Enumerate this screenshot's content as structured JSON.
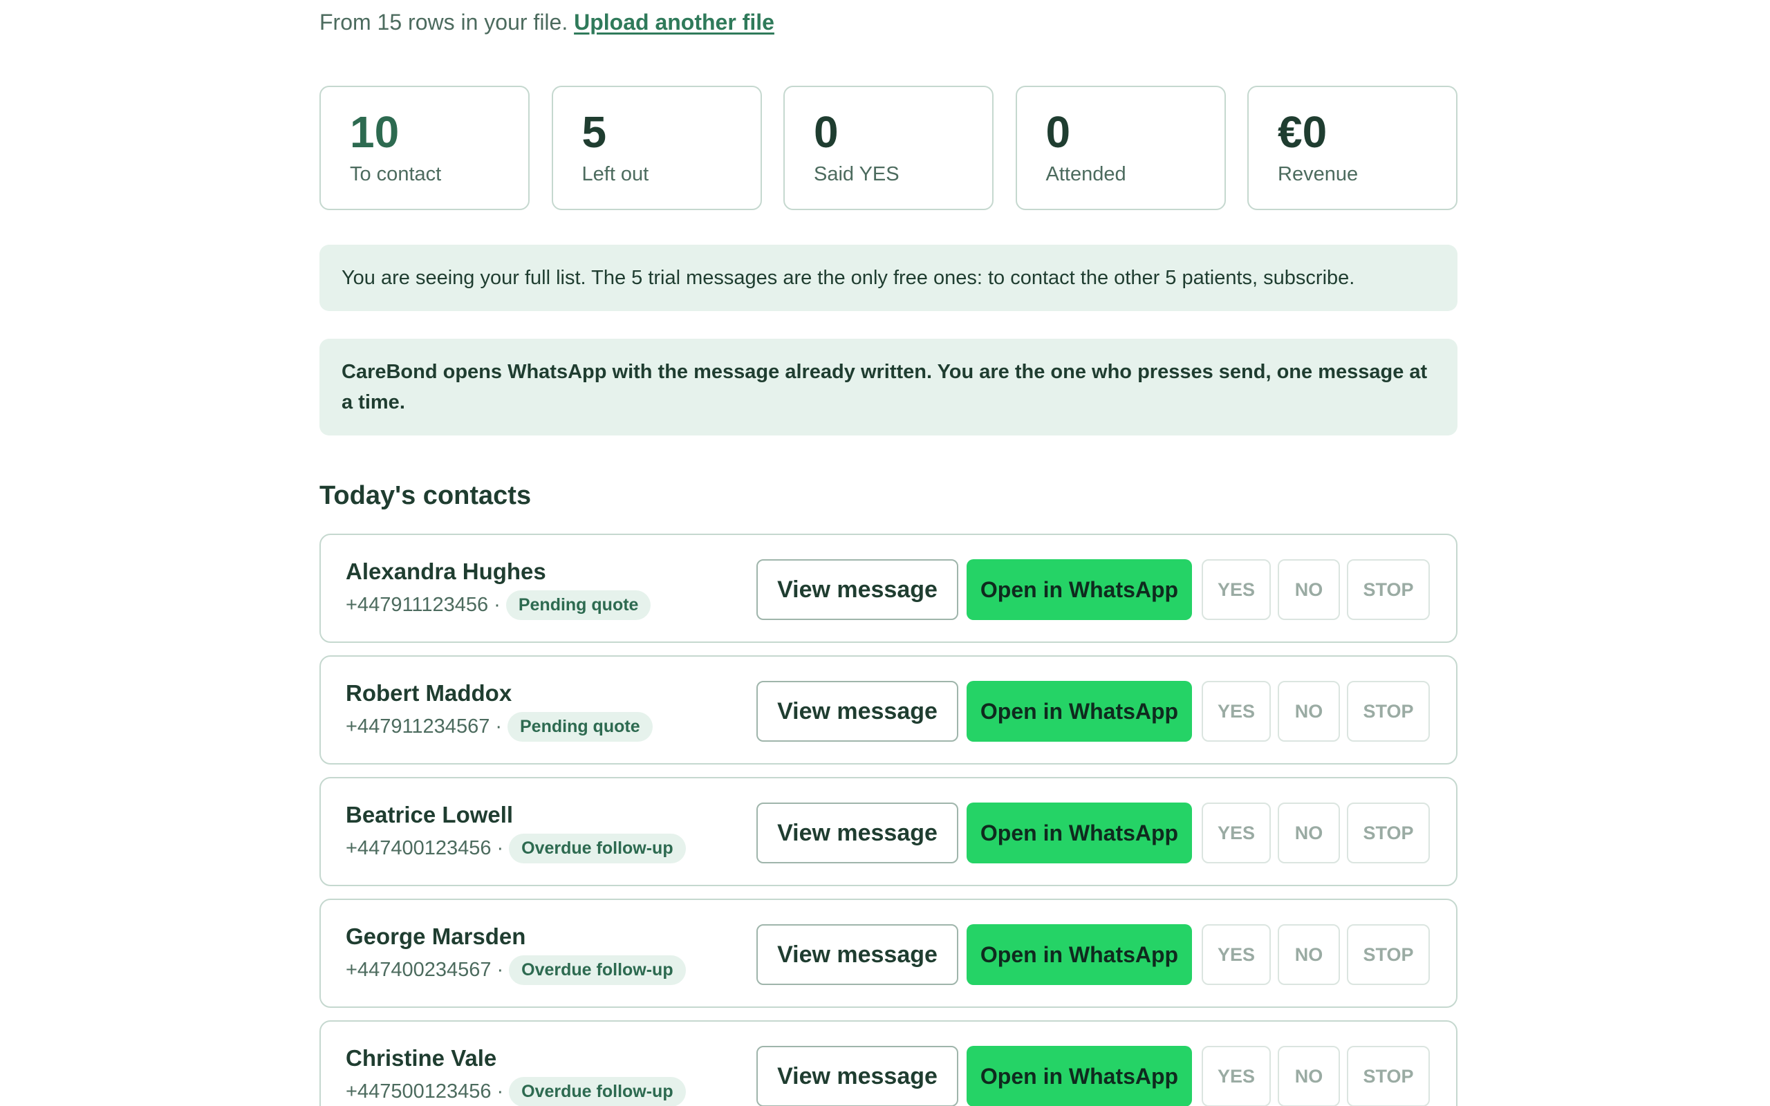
{
  "header": {
    "rows_text": "From 15 rows in your file.",
    "upload_link": "Upload another file"
  },
  "stats": [
    {
      "value": "10",
      "label": "To contact"
    },
    {
      "value": "5",
      "label": "Left out"
    },
    {
      "value": "0",
      "label": "Said YES"
    },
    {
      "value": "0",
      "label": "Attended"
    },
    {
      "value": "€0",
      "label": "Revenue"
    }
  ],
  "notices": {
    "trial": "You are seeing your full list. The 5 trial messages are the only free ones: to contact the other 5 patients, subscribe.",
    "info": "CareBond opens WhatsApp with the message already written. You are the one who presses send, one message at a time."
  },
  "contacts_section": {
    "title": "Today's contacts",
    "separator": "·",
    "buttons": {
      "view": "View message",
      "whatsapp": "Open in WhatsApp",
      "yes": "YES",
      "no": "NO",
      "stop": "STOP"
    },
    "items": [
      {
        "name": "Alexandra Hughes",
        "phone": "+447911123456",
        "tag": "Pending quote"
      },
      {
        "name": "Robert Maddox",
        "phone": "+447911234567",
        "tag": "Pending quote"
      },
      {
        "name": "Beatrice Lowell",
        "phone": "+447400123456",
        "tag": "Overdue follow-up"
      },
      {
        "name": "George Marsden",
        "phone": "+447400234567",
        "tag": "Overdue follow-up"
      },
      {
        "name": "Christine Vale",
        "phone": "+447500123456",
        "tag": "Overdue follow-up"
      }
    ]
  },
  "colors": {
    "accent_green": "#25d366",
    "dark_text": "#1f3d30",
    "badge_bg": "#e6f2ec",
    "border": "#c5d8cf"
  }
}
